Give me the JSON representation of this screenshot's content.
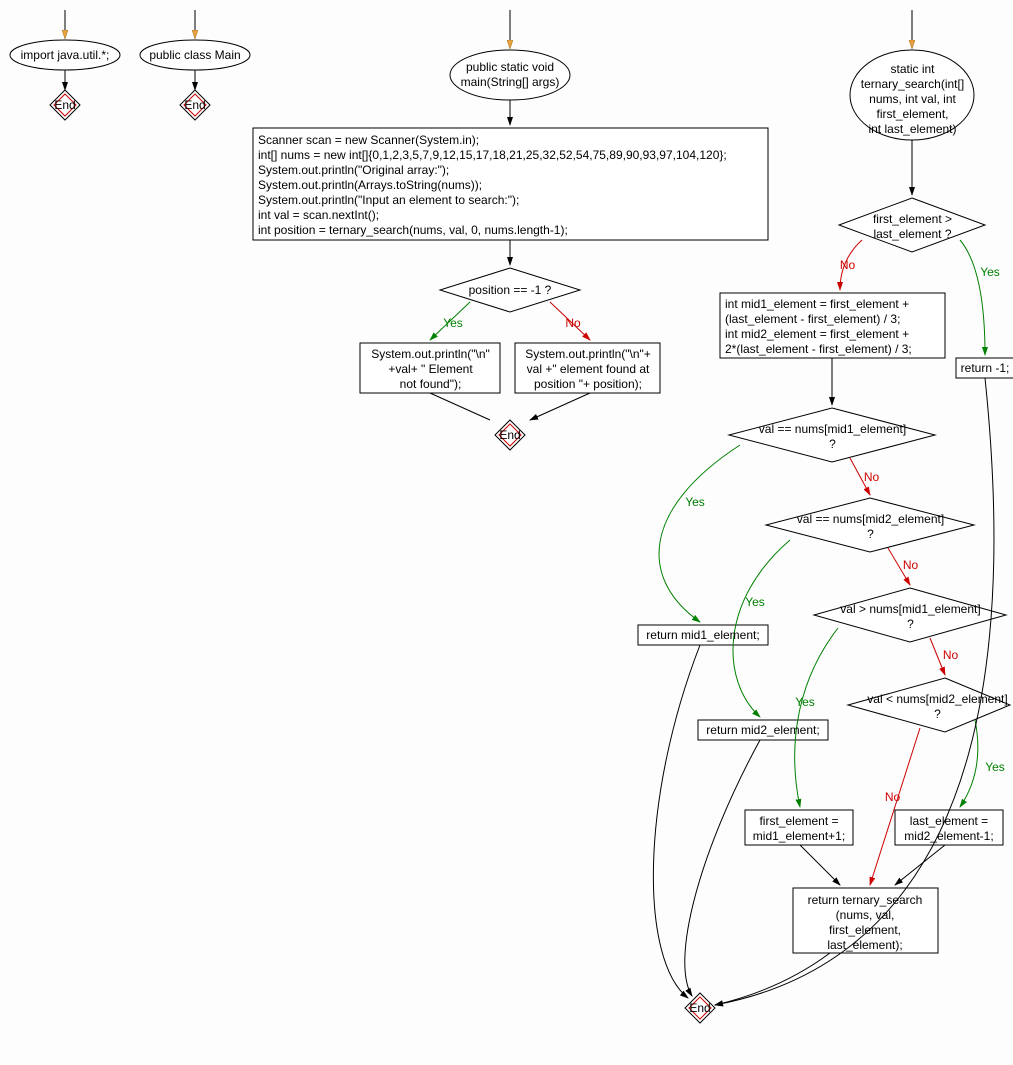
{
  "chart_data": {
    "type": "flowchart",
    "functions": [
      {
        "id": "import",
        "start": true,
        "label": "import java.util.*;",
        "end_label": "End"
      },
      {
        "id": "class",
        "start": true,
        "label": "public class Main",
        "end_label": "End"
      },
      {
        "id": "main",
        "start": true,
        "label": "public static void\nmain(String[] args)",
        "process1": "Scanner scan = new Scanner(System.in);\nint[] nums = new int[]{0,1,2,3,5,7,9,12,15,17,18,21,25,32,52,54,75,89,90,93,97,104,120};\nSystem.out.println(\"Original array:\");\nSystem.out.println(Arrays.toString(nums));\nSystem.out.println(\"Input an element to search:\");\nint val = scan.nextInt();\nint position = ternary_search(nums, val, 0, nums.length-1);",
        "decision1": "position == -1 ?",
        "yes1": "System.out.println(\"\\n\"\n+val+ \" Element\nnot found\");",
        "no1": "System.out.println(\"\\n\"+\nval +\" element found at\nposition \"+ position);",
        "end_label": "End"
      },
      {
        "id": "ternary_search",
        "start": true,
        "label": "static int\nternary_search(int[]\nnums, int val, int\nfirst_element,\nint last_element)",
        "decision1": "first_element >\nlast_element ?",
        "yes1": "return -1;",
        "no1_process": "int mid1_element = first_element +\n(last_element - first_element) / 3;\nint mid2_element = first_element +\n2*(last_element - first_element) / 3;",
        "decision2": "val == nums[mid1_element]\n?",
        "yes2": "return mid1_element;",
        "decision3": "val == nums[mid2_element]\n?",
        "yes3": "return mid2_element;",
        "decision4": "val > nums[mid1_element]\n?",
        "yes4": "first_element =\nmid1_element+1;",
        "decision5": "val < nums[mid2_element]\n?",
        "yes5": "last_element =\nmid2_element-1;",
        "final_process": "return ternary_search\n(nums, val,\nfirst_element,\nlast_element);",
        "end_label": "End"
      }
    ],
    "edge_labels": {
      "yes": "Yes",
      "no": "No"
    },
    "colors": {
      "yes_edge": "#008000",
      "no_edge": "#cc0000",
      "arrow_fill": "#e8a33d",
      "end_fill": "#ffcccc"
    }
  },
  "nodes": {
    "import_label": "import java.util.*;",
    "class_label": "public class Main",
    "main_label": "public static void\nmain(String[] args)",
    "main_block": "Scanner scan = new Scanner(System.in);\nint[] nums = new int[]{0,1,2,3,5,7,9,12,15,17,18,21,25,32,52,54,75,89,90,93,97,104,120};\nSystem.out.println(\"Original array:\");\nSystem.out.println(Arrays.toString(nums));\nSystem.out.println(\"Input an element to search:\");\nint val = scan.nextInt();\nint position = ternary_search(nums, val, 0, nums.length-1);",
    "main_decision": "position == -1 ?",
    "main_yes": "System.out.println(\"\\n\"\n+val+ \" Element\nnot found\");",
    "main_no": "System.out.println(\"\\n\"+\nval +\" element found at\nposition \"+ position);",
    "ts_label": "static int\nternary_search(int[]\nnums, int val, int\nfirst_element,\nint last_element)",
    "ts_d1": "first_element >\nlast_element ?",
    "ts_yes1": "return -1;",
    "ts_no1": "int mid1_element = first_element +\n(last_element - first_element) / 3;\nint mid2_element = first_element +\n2*(last_element - first_element) / 3;",
    "ts_d2": "val == nums[mid1_element]\n?",
    "ts_yes2": "return mid1_element;",
    "ts_d3": "val == nums[mid2_element]\n?",
    "ts_yes3": "return mid2_element;",
    "ts_d4": "val > nums[mid1_element]\n?",
    "ts_yes4": "first_element =\nmid1_element+1;",
    "ts_d5": "val < nums[mid2_element]\n?",
    "ts_yes5": "last_element =\nmid2_element-1;",
    "ts_final": "return ternary_search\n(nums, val,\nfirst_element,\nlast_element);",
    "end": "End",
    "yes": "Yes",
    "no": "No"
  }
}
